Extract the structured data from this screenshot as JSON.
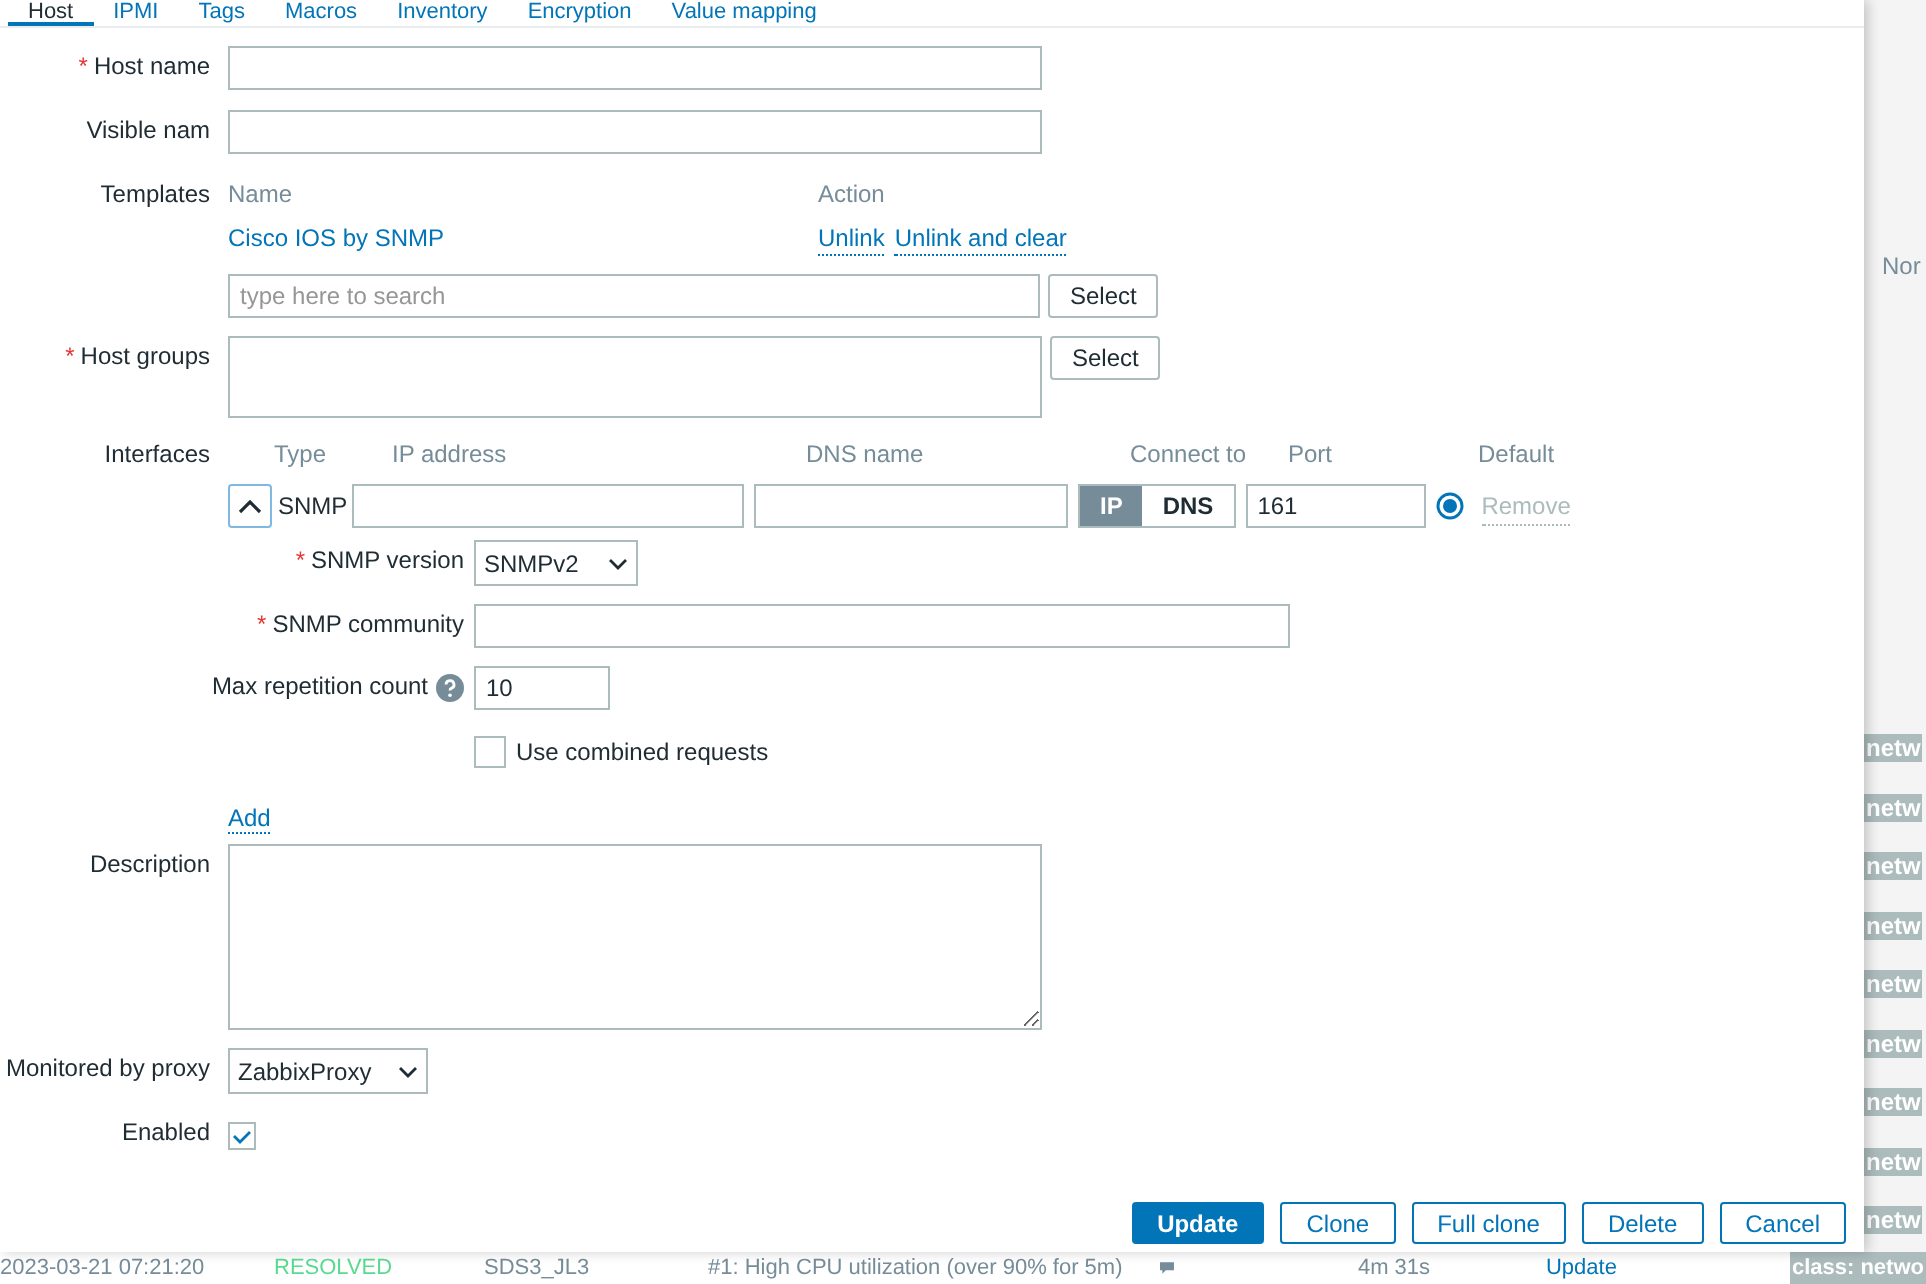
{
  "tabs": [
    {
      "label": "Host",
      "selected": true
    },
    {
      "label": "IPMI",
      "selected": false
    },
    {
      "label": "Tags",
      "selected": false
    },
    {
      "label": "Macros",
      "selected": false
    },
    {
      "label": "Inventory",
      "selected": false
    },
    {
      "label": "Encryption",
      "selected": false
    },
    {
      "label": "Value mapping",
      "selected": false
    }
  ],
  "form": {
    "required_marker": "*",
    "host_name": {
      "label": "Host name",
      "required": true
    },
    "visible_name": {
      "label": "Visible nam"
    },
    "templates": {
      "label": "Templates",
      "columns": [
        "Name",
        "Action"
      ],
      "linked": [
        {
          "name": "Cisco IOS by SNMP",
          "actions": [
            "Unlink",
            "Unlink and clear"
          ]
        }
      ],
      "search": {
        "placeholder": "type here to search"
      },
      "select_button": "Select"
    },
    "host_groups": {
      "label": "Host groups",
      "required": true,
      "select_button": "Select"
    },
    "interfaces": {
      "label": "Interfaces",
      "columns": [
        "Type",
        "IP address",
        "DNS name",
        "Connect to",
        "Port",
        "Default"
      ],
      "items": [
        {
          "type": "SNMP",
          "expanded": true,
          "connect_to": [
            {
              "label": "IP",
              "selected": true
            },
            {
              "label": "DNS",
              "selected": false
            }
          ],
          "port": "161",
          "default": true,
          "remove": "Remove",
          "snmp_version": {
            "label": "SNMP version",
            "required": true,
            "value": "SNMPv2"
          },
          "snmp_community": {
            "label": "SNMP community",
            "required": true
          },
          "max_repetition": {
            "label": "Max repetition count",
            "value": "10"
          },
          "combined_requests": {
            "label": "Use combined requests",
            "checked": false
          }
        }
      ],
      "add": "Add"
    },
    "description": {
      "label": "Description"
    },
    "proxy": {
      "label": "Monitored by proxy",
      "value": "ZabbixProxy"
    },
    "enabled": {
      "label": "Enabled",
      "checked": true
    }
  },
  "buttons": [
    {
      "label": "Update",
      "primary": true
    },
    {
      "label": "Clone",
      "primary": false
    },
    {
      "label": "Full clone",
      "primary": false
    },
    {
      "label": "Delete",
      "primary": false
    },
    {
      "label": "Cancel",
      "primary": false
    }
  ],
  "background": {
    "column_header": "Nor",
    "tags": [
      "netw",
      "netw",
      "netw",
      "netw",
      "netw",
      "netw",
      "netw",
      "netw",
      "netw"
    ],
    "row": {
      "time": "2023-03-21 07:21:20",
      "status": "RESOLVED",
      "host": "SDS3_JL3",
      "problem": "#1: High CPU utilization (over 90% for 5m)",
      "duration": "4m 31s",
      "action": "Update",
      "tag": "class: netwo"
    }
  }
}
